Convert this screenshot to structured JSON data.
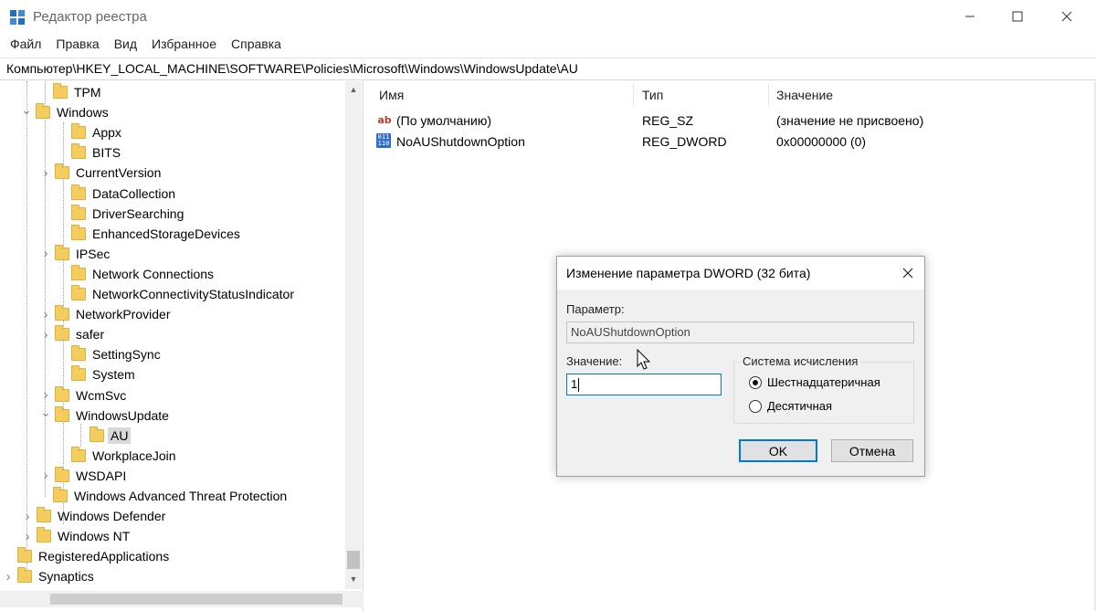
{
  "window": {
    "title": "Редактор реестра"
  },
  "menu": [
    "Файл",
    "Правка",
    "Вид",
    "Избранное",
    "Справка"
  ],
  "address": "Компьютер\\HKEY_LOCAL_MACHINE\\SOFTWARE\\Policies\\Microsoft\\Windows\\WindowsUpdate\\AU",
  "tree": [
    {
      "label": "TPM",
      "expander": ""
    },
    {
      "label": "Windows",
      "expander": "expanded"
    },
    {
      "label": "Appx",
      "expander": ""
    },
    {
      "label": "BITS",
      "expander": ""
    },
    {
      "label": "CurrentVersion",
      "expander": "collapsed"
    },
    {
      "label": "DataCollection",
      "expander": ""
    },
    {
      "label": "DriverSearching",
      "expander": ""
    },
    {
      "label": "EnhancedStorageDevices",
      "expander": ""
    },
    {
      "label": "IPSec",
      "expander": "collapsed"
    },
    {
      "label": "Network Connections",
      "expander": ""
    },
    {
      "label": "NetworkConnectivityStatusIndicator",
      "expander": ""
    },
    {
      "label": "NetworkProvider",
      "expander": "collapsed"
    },
    {
      "label": "safer",
      "expander": "collapsed"
    },
    {
      "label": "SettingSync",
      "expander": ""
    },
    {
      "label": "System",
      "expander": ""
    },
    {
      "label": "WcmSvc",
      "expander": "collapsed"
    },
    {
      "label": "WindowsUpdate",
      "expander": "expanded"
    },
    {
      "label": "AU",
      "expander": "",
      "selected": true
    },
    {
      "label": "WorkplaceJoin",
      "expander": ""
    },
    {
      "label": "WSDAPI",
      "expander": "collapsed"
    },
    {
      "label": "Windows Advanced Threat Protection",
      "expander": ""
    },
    {
      "label": "Windows Defender",
      "expander": "collapsed"
    },
    {
      "label": "Windows NT",
      "expander": "collapsed"
    },
    {
      "label": "RegisteredApplications",
      "expander": ""
    },
    {
      "label": "Synaptics",
      "expander": "collapsed"
    }
  ],
  "list": {
    "columns": [
      "Имя",
      "Тип",
      "Значение"
    ],
    "rows": [
      {
        "icon": "string-value-icon",
        "name": "(По умолчанию)",
        "type": "REG_SZ",
        "value": "(значение не присвоено)"
      },
      {
        "icon": "dword-value-icon",
        "name": "NoAUShutdownOption",
        "type": "REG_DWORD",
        "value": "0x00000000 (0)"
      }
    ]
  },
  "dialog": {
    "title": "Изменение параметра DWORD (32 бита)",
    "param_label": "Параметр:",
    "param_value": "NoAUShutdownOption",
    "value_label": "Значение:",
    "value": "1",
    "base_group": "Система исчисления",
    "base_options": [
      {
        "label": "Шестнадцатеричная",
        "checked": true
      },
      {
        "label": "Десятичная",
        "checked": false
      }
    ],
    "ok": "OK",
    "cancel": "Отмена"
  },
  "colors": {
    "accent": "#0078d7",
    "folder": "#f3cd5e",
    "selection": "#d9d9d9"
  }
}
